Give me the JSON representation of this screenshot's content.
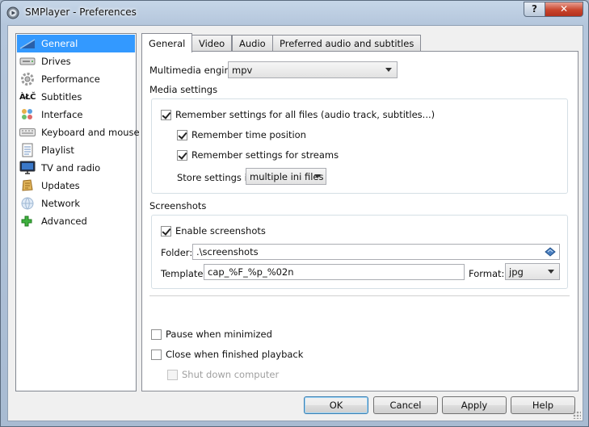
{
  "window": {
    "title": "SMPlayer - Preferences",
    "help_label": "?",
    "close_label": "✕"
  },
  "sidebar": {
    "items": [
      {
        "label": "General",
        "icon": "general-icon"
      },
      {
        "label": "Drives",
        "icon": "drives-icon"
      },
      {
        "label": "Performance",
        "icon": "performance-icon"
      },
      {
        "label": "Subtitles",
        "icon": "subtitles-icon",
        "glyph": "ÀŁČ"
      },
      {
        "label": "Interface",
        "icon": "interface-icon"
      },
      {
        "label": "Keyboard and mouse",
        "icon": "keyboard-icon"
      },
      {
        "label": "Playlist",
        "icon": "playlist-icon"
      },
      {
        "label": "TV and radio",
        "icon": "tv-icon"
      },
      {
        "label": "Updates",
        "icon": "updates-icon"
      },
      {
        "label": "Network",
        "icon": "network-icon"
      },
      {
        "label": "Advanced",
        "icon": "advanced-icon"
      }
    ],
    "selected": "General"
  },
  "tabs": [
    {
      "label": "General"
    },
    {
      "label": "Video"
    },
    {
      "label": "Audio"
    },
    {
      "label": "Preferred audio and subtitles"
    }
  ],
  "general": {
    "engine_label": "Multimedia engine:",
    "engine_value": "mpv",
    "media_settings_title": "Media settings",
    "remember_all": {
      "label": "Remember settings for all files (audio track, subtitles...)",
      "checked": true
    },
    "remember_time": {
      "label": "Remember time position",
      "checked": true
    },
    "remember_streams": {
      "label": "Remember settings for streams",
      "checked": true
    },
    "store_label": "Store settings in",
    "store_value": "multiple ini files",
    "screenshots_title": "Screenshots",
    "enable_screenshots": {
      "label": "Enable screenshots",
      "checked": true
    },
    "folder_label": "Folder:",
    "folder_value": ".\\screenshots",
    "template_label": "Template:",
    "template_value": "cap_%F_%p_%02n",
    "format_label": "Format:",
    "format_value": "jpg",
    "pause_minimized": {
      "label": "Pause when minimized",
      "checked": false
    },
    "close_finished": {
      "label": "Close when finished playback",
      "checked": false
    },
    "shutdown": {
      "label": "Shut down computer",
      "checked": false,
      "disabled": true
    }
  },
  "buttons": {
    "ok": "OK",
    "cancel": "Cancel",
    "apply": "Apply",
    "help": "Help"
  },
  "colors": {
    "selection": "#3399ff",
    "default_button_border": "#3c7fb1"
  }
}
